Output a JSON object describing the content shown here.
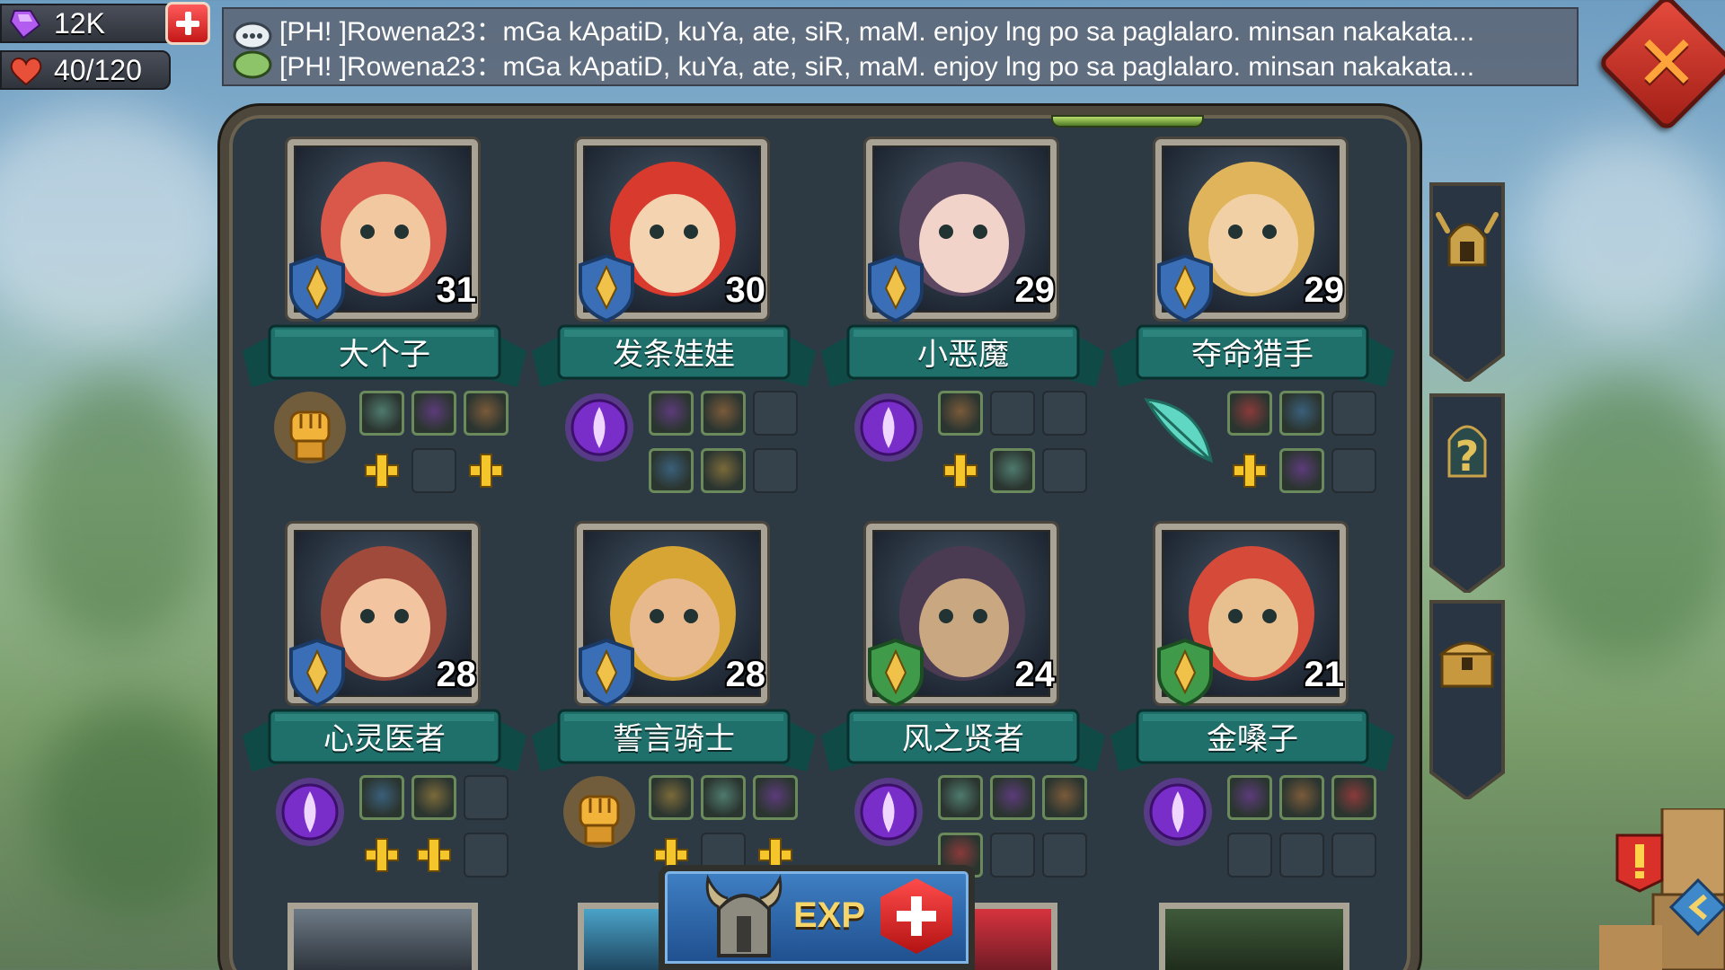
{
  "resources": {
    "gems": "12K",
    "stamina": "40/120"
  },
  "chat": {
    "lines": [
      "[PH! ]Rowena23：mGa kApatiD, kuYa, ate, siR, maM. enjoy lng po sa paglalaro. minsan nakakata...",
      "[PH! ]Rowena23：mGa kApatiD, kuYa, ate, siR, maM. enjoy lng po sa paglalaro. minsan nakakata..."
    ]
  },
  "heroes": [
    {
      "name": "大个子",
      "level": "31",
      "type": "fist-icon",
      "shield": "blue"
    },
    {
      "name": "发条娃娃",
      "level": "30",
      "type": "magic-orb-icon",
      "shield": "blue"
    },
    {
      "name": "小恶魔",
      "level": "29",
      "type": "magic-orb-icon",
      "shield": "blue"
    },
    {
      "name": "夺命猎手",
      "level": "29",
      "type": "feather-icon",
      "shield": "blue"
    },
    {
      "name": "心灵医者",
      "level": "28",
      "type": "magic-orb-icon",
      "shield": "blue"
    },
    {
      "name": "誓言骑士",
      "level": "28",
      "type": "fist-icon",
      "shield": "blue"
    },
    {
      "name": "风之贤者",
      "level": "24",
      "type": "magic-orb-icon",
      "shield": "green"
    },
    {
      "name": "金嗓子",
      "level": "21",
      "type": "magic-orb-icon",
      "shield": "green"
    }
  ],
  "exp_button": {
    "label": "EXP"
  },
  "colors": {
    "panel": "#2d3a44",
    "banner": "#1f6f6a",
    "plus": "#f4c62c",
    "close": "#c9322a"
  }
}
